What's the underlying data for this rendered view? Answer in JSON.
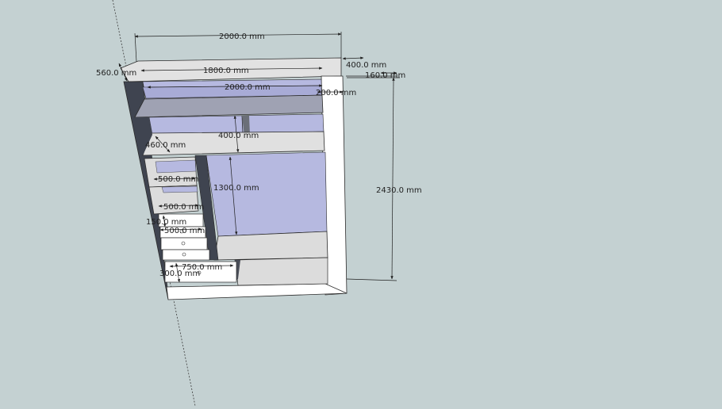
{
  "scene": {
    "background_color": "#c4d1d2",
    "panel_color": "#dcdcdc",
    "panel_light": "#ffffff",
    "panel_dark": "#3f4450",
    "back_wall_color": "#b8bbe0",
    "edge_color": "#2b2b2b"
  },
  "dimensions": {
    "top_width": "2000.0 mm",
    "inner_top_width": "1800.0 mm",
    "top_depth_left": "560.0 mm",
    "top_depth_right": "400.0 mm",
    "right_side_depth": "160.0 mm",
    "shelf_width": "2000.0 mm",
    "side_gap": "200.0 mm",
    "total_height": "2430.0 mm",
    "upper_shelf_height": "400.0 mm",
    "upper_shelf_depth": "460.0 mm",
    "drawer_width_1": "500.0 mm",
    "drawer_width_2": "500.0 mm",
    "drawer_width_3": "500.0 mm",
    "hanging_height": "1300.0 mm",
    "drawer_height": "150.0 mm",
    "bottom_width": "750.0 mm",
    "bottom_height": "300.0 mm"
  }
}
